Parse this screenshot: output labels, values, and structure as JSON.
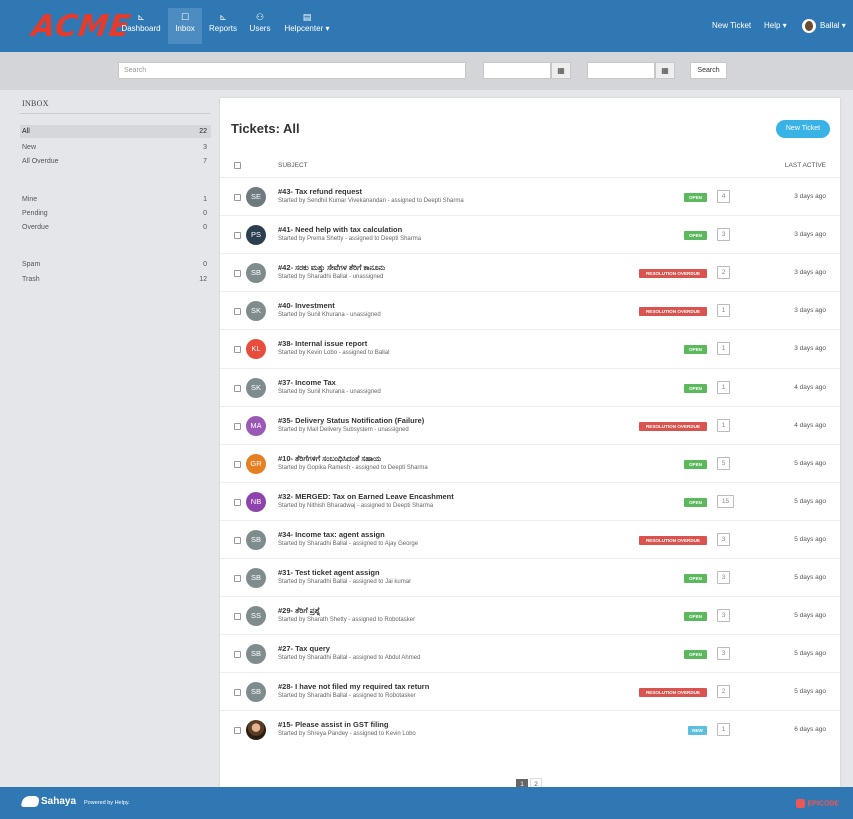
{
  "brand": {
    "logo": "ACME"
  },
  "nav": {
    "items": [
      {
        "label": "Dashboard",
        "icon": "dashboard-icon",
        "glyph": "⊾"
      },
      {
        "label": "Inbox",
        "icon": "inbox-icon",
        "glyph": "☐"
      },
      {
        "label": "Reports",
        "icon": "reports-icon",
        "glyph": "⊾"
      },
      {
        "label": "Users",
        "icon": "users-icon",
        "glyph": "⚇"
      },
      {
        "label": "Helpcenter ▾",
        "icon": "helpcenter-icon",
        "glyph": "▤"
      }
    ],
    "new_ticket": "New Ticket",
    "help": "Help ▾",
    "user": "Ballal ▾"
  },
  "search": {
    "placeholder": "Search",
    "button": "Search",
    "calendar_glyph": "▦"
  },
  "sidebar": {
    "heading": "INBOX",
    "items": [
      {
        "label": "All",
        "count": "22"
      },
      {
        "label": "New",
        "count": "3"
      },
      {
        "label": "All Overdue",
        "count": "7"
      },
      {
        "label": "Mine",
        "count": "1"
      },
      {
        "label": "Pending",
        "count": "0"
      },
      {
        "label": "Overdue",
        "count": "0"
      },
      {
        "label": "Spam",
        "count": "0"
      },
      {
        "label": "Trash",
        "count": "12"
      }
    ]
  },
  "main": {
    "title": "Tickets: All",
    "new_ticket_button": "New Ticket",
    "col_subject": "SUBJECT",
    "col_last_active": "LAST ACTIVE"
  },
  "tickets": [
    {
      "initials": "SE",
      "color": "#6d7a80",
      "subject": "#43- Tax refund request",
      "meta": "Started by Sendhil Kumar Vivekanandan - assigned to Deepti Sharma",
      "status": "OPEN",
      "count": "4",
      "last": "3 days ago"
    },
    {
      "initials": "PS",
      "color": "#2c3e50",
      "subject": "#41- Need help with tax calculation",
      "meta": "Started by Prema Shetty - assigned to Deepti Sharma",
      "status": "OPEN",
      "count": "3",
      "last": "3 days ago"
    },
    {
      "initials": "SB",
      "color": "#7f8c8d",
      "subject": "#42- ಸರಕು ಮತ್ತು ಸೇವೆಗಳ ತೆರಿಗೆ ಕಾನೂನು",
      "meta": "Started by Sharadhi Ballal - unassigned",
      "status": "RESOLUTION OVERDUE",
      "count": "2",
      "last": "3 days ago"
    },
    {
      "initials": "SK",
      "color": "#7f8c8d",
      "subject": "#40- Investment",
      "meta": "Started by Sunil Khurana - unassigned",
      "status": "RESOLUTION OVERDUE",
      "count": "1",
      "last": "3 days ago"
    },
    {
      "initials": "KL",
      "color": "#e74c3c",
      "subject": "#38- Internal issue report",
      "meta": "Started by Kevin Lobo - assigned to Ballal",
      "status": "OPEN",
      "count": "1",
      "last": "3 days ago"
    },
    {
      "initials": "SK",
      "color": "#7f8c8d",
      "subject": "#37- Income Tax",
      "meta": "Started by Sunil Khurana - unassigned",
      "status": "OPEN",
      "count": "1",
      "last": "4 days ago"
    },
    {
      "initials": "MA",
      "color": "#9b59b6",
      "subject": "#35- Delivery Status Notification (Failure)",
      "meta": "Started by Mail Delivery Subsystem - unassigned",
      "status": "RESOLUTION OVERDUE",
      "count": "1",
      "last": "4 days ago"
    },
    {
      "initials": "GR",
      "color": "#e67e22",
      "subject": "#10- ತೆರಿಗೆಗಳಿಗೆ ಸಂಬಂಧಿಸಿದಂತೆ ಸಹಾಯ",
      "meta": "Started by Gopika Ramesh - assigned to Deepti Sharma",
      "status": "OPEN",
      "count": "5",
      "last": "5 days ago"
    },
    {
      "initials": "NB",
      "color": "#8e44ad",
      "subject": "#32- MERGED: Tax on Earned Leave Encashment",
      "meta": "Started by Nithish Bharadwaj - assigned to Deepti Sharma",
      "status": "OPEN",
      "count": "15",
      "last": "5 days ago"
    },
    {
      "initials": "SB",
      "color": "#7f8c8d",
      "subject": "#34- Income tax: agent assign",
      "meta": "Started by Sharadhi Ballal - assigned to Ajay George",
      "status": "RESOLUTION OVERDUE",
      "count": "3",
      "last": "5 days ago"
    },
    {
      "initials": "SB",
      "color": "#7f8c8d",
      "subject": "#31- Test ticket agent assign",
      "meta": "Started by Sharadhi Ballal - assigned to Jai kumar",
      "status": "OPEN",
      "count": "3",
      "last": "5 days ago"
    },
    {
      "initials": "SS",
      "color": "#7f8c8d",
      "subject": "#29- ತೆರಿಗೆ ಪ್ರಶ್ನೆ",
      "meta": "Started by Sharath Shetty - assigned to Robotasker",
      "status": "OPEN",
      "count": "3",
      "last": "5 days ago"
    },
    {
      "initials": "SB",
      "color": "#7f8c8d",
      "subject": "#27- Tax query",
      "meta": "Started by Sharadhi Ballal - assigned to Abdul Ahmed",
      "status": "OPEN",
      "count": "3",
      "last": "5 days ago"
    },
    {
      "initials": "SB",
      "color": "#7f8c8d",
      "subject": "#28- I have not filed my required tax return",
      "meta": "Started by Sharadhi Ballal - assigned to Robotasker",
      "status": "RESOLUTION OVERDUE",
      "count": "2",
      "last": "5 days ago"
    },
    {
      "initials": "",
      "color": "#5a3b26",
      "photo": true,
      "subject": "#15- Please assist in GST filing",
      "meta": "Started by Shreya Pandey - assigned to Kevin Lobo",
      "status": "NEW",
      "count": "1",
      "last": "6 days ago"
    }
  ],
  "pagination": {
    "pages": [
      "1",
      "2"
    ],
    "current": "1"
  },
  "footer": {
    "brand": "Sahaya",
    "powered": "Powered by Helpy.",
    "partner": "EPICODE"
  }
}
